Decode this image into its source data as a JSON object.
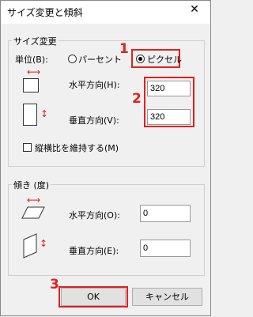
{
  "window": {
    "title": "サイズ変更と傾斜",
    "close_glyph": "✕"
  },
  "resize_group": {
    "label": "サイズ変更",
    "unit_label": "単位(B):",
    "percent_label": "パーセント",
    "pixel_label": "ピクセル",
    "horizontal_label": "水平方向(H):",
    "horizontal_value": "320",
    "vertical_label": "垂直方向(V):",
    "vertical_value": "320",
    "keep_ratio_label": "縦横比を維持する(M)"
  },
  "skew_group": {
    "label": "傾き (度)",
    "horizontal_label": "水平方向(O):",
    "horizontal_value": "0",
    "vertical_label": "垂直方向(E):",
    "vertical_value": "0"
  },
  "annotations": {
    "one": "1",
    "two": "2",
    "three": "3"
  },
  "buttons": {
    "ok": "OK",
    "cancel": "キャンセル"
  },
  "accent_color": "#e02020"
}
